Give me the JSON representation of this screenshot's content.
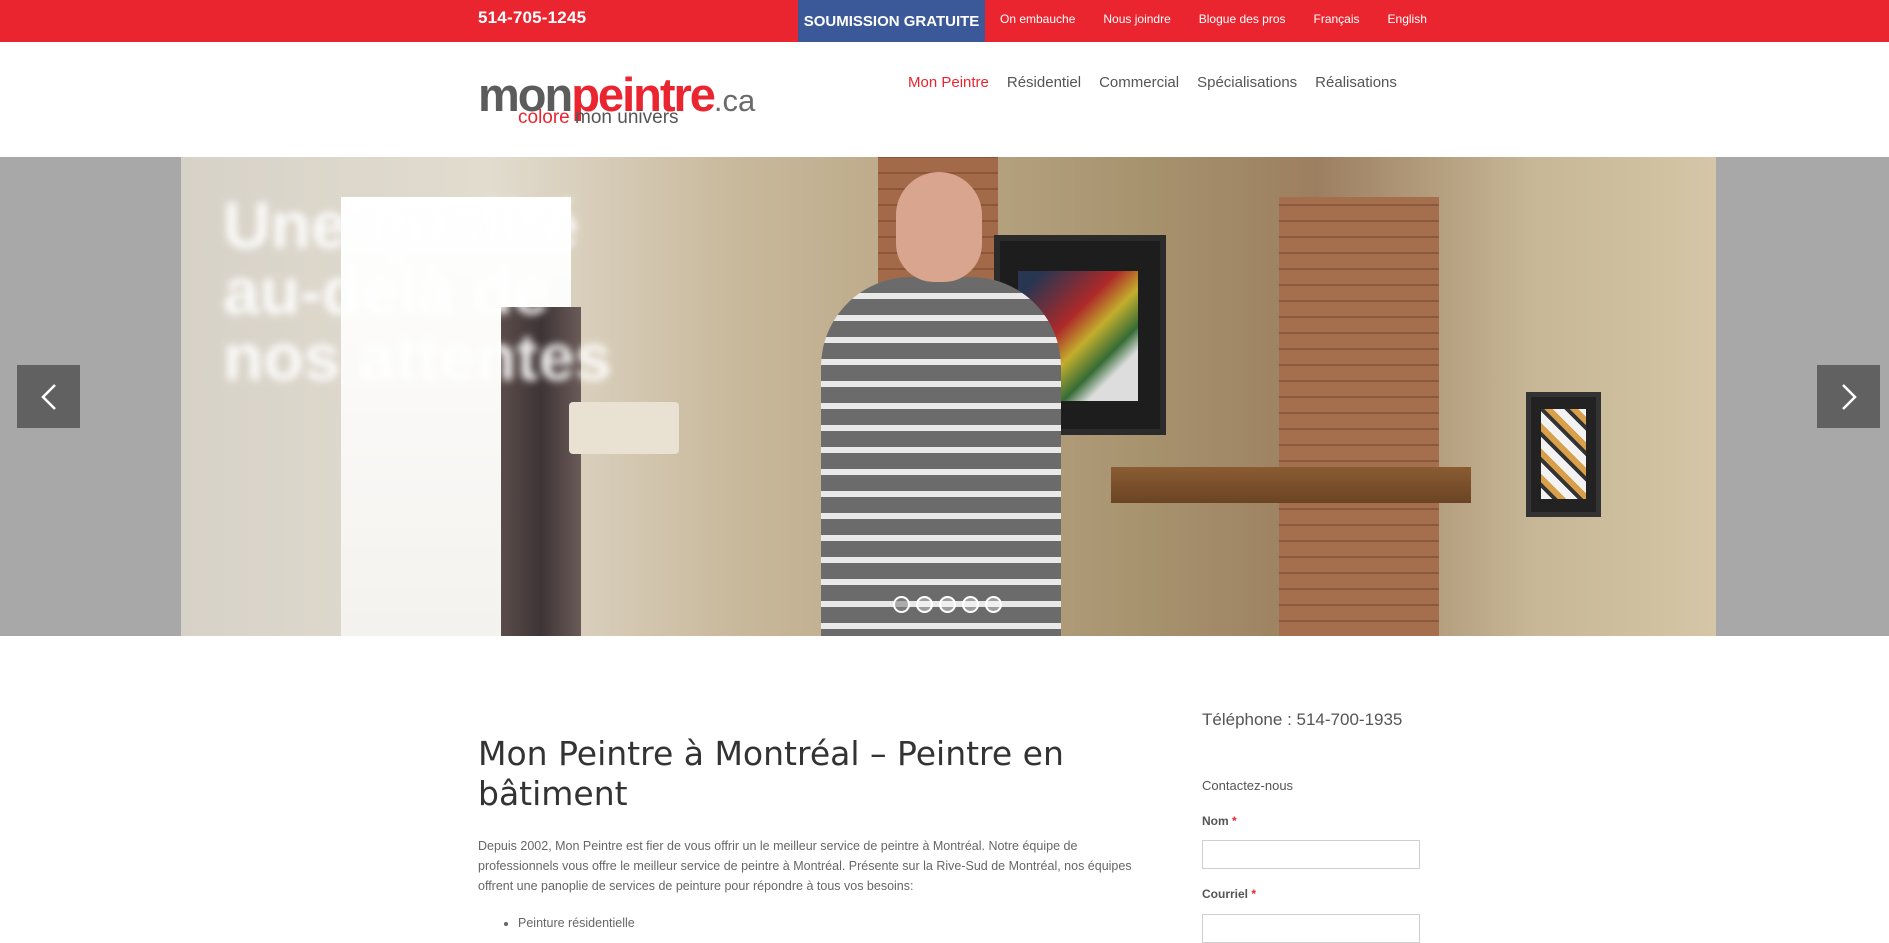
{
  "topbar": {
    "phone": "514-705-1245",
    "quote_button": "SOUMISSION GRATUITE",
    "links": [
      "On embauche",
      "Nous joindre",
      "Blogue des pros",
      "Français",
      "English"
    ]
  },
  "logo": {
    "mon": "mon",
    "peintre": "peintre",
    "ca": ".ca",
    "colore": "colore",
    "univers": "mon univers"
  },
  "nav": {
    "items": [
      "Mon Peintre",
      "Résidentiel",
      "Commercial",
      "Spécialisations",
      "Réalisations"
    ],
    "active_index": 0
  },
  "slider": {
    "title": "Une qualité au-delà de nos attentes",
    "prev_icon": "chevron-left-icon",
    "next_icon": "chevron-right-icon",
    "dot_count": 5,
    "active_dot": 0
  },
  "main": {
    "title": "Mon Peintre à Montréal – Peintre en bâtiment",
    "intro": "Depuis 2002, Mon Peintre est fier de vous offrir un le meilleur service de peintre à Montréal. Notre équipe de professionnels vous offre le meilleur service de peintre à Montréal. Présente sur la Rive-Sud de Montréal, nos équipes offrent une panoplie de services de peinture pour répondre à tous vos besoins:",
    "list": [
      "Peinture résidentielle"
    ]
  },
  "sidebar": {
    "phone": "Téléphone : 514-700-1935",
    "contact_title": "Contactez-nous",
    "name_label": "Nom",
    "email_label": "Courriel",
    "required_mark": "*"
  },
  "colors": {
    "brand_red": "#ea2530",
    "quote_blue": "#3b5998"
  }
}
